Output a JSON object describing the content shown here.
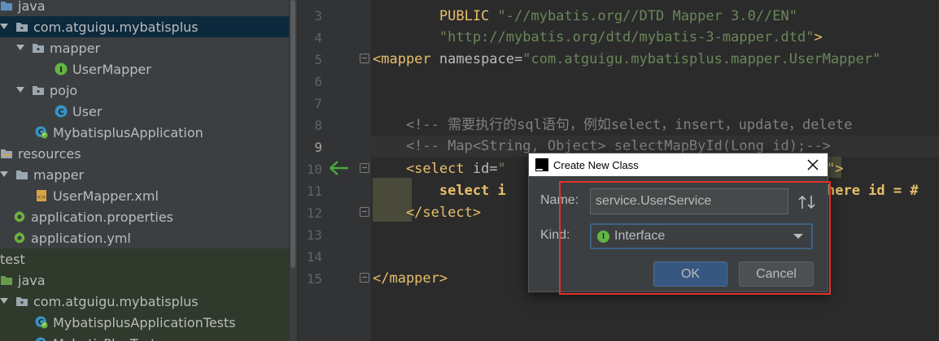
{
  "tree": {
    "items": [
      {
        "label": "java",
        "indent": 0,
        "arrow": "none",
        "icon": "folder-blue-icon",
        "row": 0
      },
      {
        "label": "com.atguigu.mybatisplus",
        "indent": 0,
        "arrow": "down",
        "icon": "package-icon",
        "row": 1,
        "selected": true
      },
      {
        "label": "mapper",
        "indent": 1,
        "arrow": "down",
        "icon": "package-icon",
        "row": 2
      },
      {
        "label": "UserMapper",
        "indent": 2,
        "arrow": "none",
        "icon": "interface-icon",
        "row": 3
      },
      {
        "label": "pojo",
        "indent": 1,
        "arrow": "down",
        "icon": "package-icon",
        "row": 4
      },
      {
        "label": "User",
        "indent": 2,
        "arrow": "none",
        "icon": "class-icon",
        "row": 5
      },
      {
        "label": "MybatisplusApplication",
        "indent": 1,
        "arrow": "none",
        "icon": "spring-class-icon",
        "row": 6
      },
      {
        "label": "resources",
        "indent": 0,
        "arrow": "none",
        "icon": "resources-folder-icon",
        "row": 7
      },
      {
        "label": "mapper",
        "indent": 0,
        "arrow": "down",
        "icon": "folder-icon",
        "row": 8
      },
      {
        "label": "UserMapper.xml",
        "indent": 1,
        "arrow": "none",
        "icon": "xml-file-icon",
        "row": 9
      },
      {
        "label": "application.properties",
        "indent": 0,
        "arrow": "none",
        "icon": "spring-config-icon",
        "row": 10
      },
      {
        "label": "application.yml",
        "indent": 0,
        "arrow": "none",
        "icon": "spring-config-icon",
        "row": 11
      },
      {
        "label": "test",
        "indent": 0,
        "arrow": "none",
        "icon": "",
        "row": 12,
        "test": true
      },
      {
        "label": "java",
        "indent": 0,
        "arrow": "none",
        "icon": "folder-green-icon",
        "row": 13,
        "test": true
      },
      {
        "label": "com.atguigu.mybatisplus",
        "indent": 0,
        "arrow": "down",
        "icon": "package-icon",
        "row": 14,
        "test": true
      },
      {
        "label": "MybatisplusApplicationTests",
        "indent": 1,
        "arrow": "none",
        "icon": "spring-class-icon",
        "row": 15,
        "test": true
      },
      {
        "label": "MybatisPlusTest",
        "indent": 1,
        "arrow": "none",
        "icon": "spring-class-icon",
        "row": 16,
        "test": true
      }
    ]
  },
  "editor": {
    "line_numbers": [
      "3",
      "4",
      "5",
      "6",
      "7",
      "8",
      "9",
      "10",
      "11",
      "12",
      "13",
      "14",
      "15"
    ],
    "current_line": "9",
    "lines": {
      "l3a": "        PUBLIC ",
      "l3b": "\"-//mybatis.org//DTD Mapper 3.0//EN\"",
      "l4": "        \"http://mybatis.org/dtd/mybatis-3-mapper.dtd\"",
      "l4end": ">",
      "l5a": "<mapper ",
      "l5b": "namespace=",
      "l5c": "\"com.atguigu.mybatisplus.mapper.UserMapper\"",
      "l8": "    <!-- 需要执行的sql语句，例如select，insert，update，delete",
      "l9": "    <!-- Map<String, Object> selectMapById(Long id);-->",
      "l10a": "    <select ",
      "l10b": "id=",
      "l10c": "\"",
      "l10d": "\">",
      "l11a": "        select i",
      "l11b": "here id = #",
      "l12": "    </select>",
      "l15": "</mapper>"
    }
  },
  "dialog": {
    "title": "Create New Class",
    "name_label": "Name:",
    "name_value": "service.UserService",
    "kind_label": "Kind:",
    "kind_value": "Interface",
    "kind_badge": "I",
    "ok_label": "OK",
    "cancel_label": "Cancel"
  },
  "colors": {
    "highlight_box": "#e0322d",
    "ok_button": "#365880",
    "selection": "#0d293e"
  }
}
